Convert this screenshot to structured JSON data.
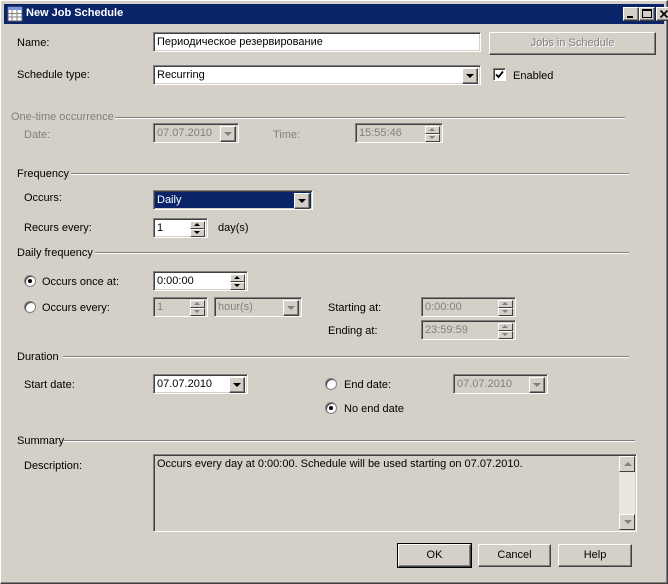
{
  "window": {
    "title": "New Job Schedule"
  },
  "labels": {
    "name": "Name:",
    "schedule_type": "Schedule type:",
    "enabled": "Enabled",
    "jobs_in_schedule": "Jobs in Schedule"
  },
  "values": {
    "name": "Периодическое резервирование",
    "schedule_type": "Recurring",
    "enabled_checked": true
  },
  "one_time": {
    "group": "One-time occurrence",
    "date_label": "Date:",
    "date_value": "07.07.2010",
    "time_label": "Time:",
    "time_value": "15:55:46"
  },
  "frequency": {
    "group": "Frequency",
    "occurs_label": "Occurs:",
    "occurs_value": "Daily",
    "recurs_label": "Recurs every:",
    "recurs_value": "1",
    "recurs_unit": "day(s)"
  },
  "daily": {
    "group": "Daily frequency",
    "once_label": "Occurs once at:",
    "once_value": "0:00:00",
    "every_label": "Occurs every:",
    "every_value": "1",
    "every_unit": "hour(s)",
    "starting_label": "Starting at:",
    "starting_value": "0:00:00",
    "ending_label": "Ending at:",
    "ending_value": "23:59:59"
  },
  "duration": {
    "group": "Duration",
    "start_label": "Start date:",
    "start_value": "07.07.2010",
    "end_label": "End date:",
    "end_value": "07.07.2010",
    "no_end_label": "No end date"
  },
  "summary": {
    "group": "Summary",
    "desc_label": "Description:",
    "desc_value": "Occurs every day at 0:00:00. Schedule will be used starting on 07.07.2010."
  },
  "buttons": {
    "ok": "OK",
    "cancel": "Cancel",
    "help": "Help"
  },
  "colors": {
    "titlebar": "#0a246a",
    "face": "#d4d0c8",
    "disabled_text": "#808080"
  },
  "icons": {
    "window": "grid-icon",
    "minimize": "minimize-icon",
    "maximize": "maximize-icon",
    "close": "close-icon"
  }
}
